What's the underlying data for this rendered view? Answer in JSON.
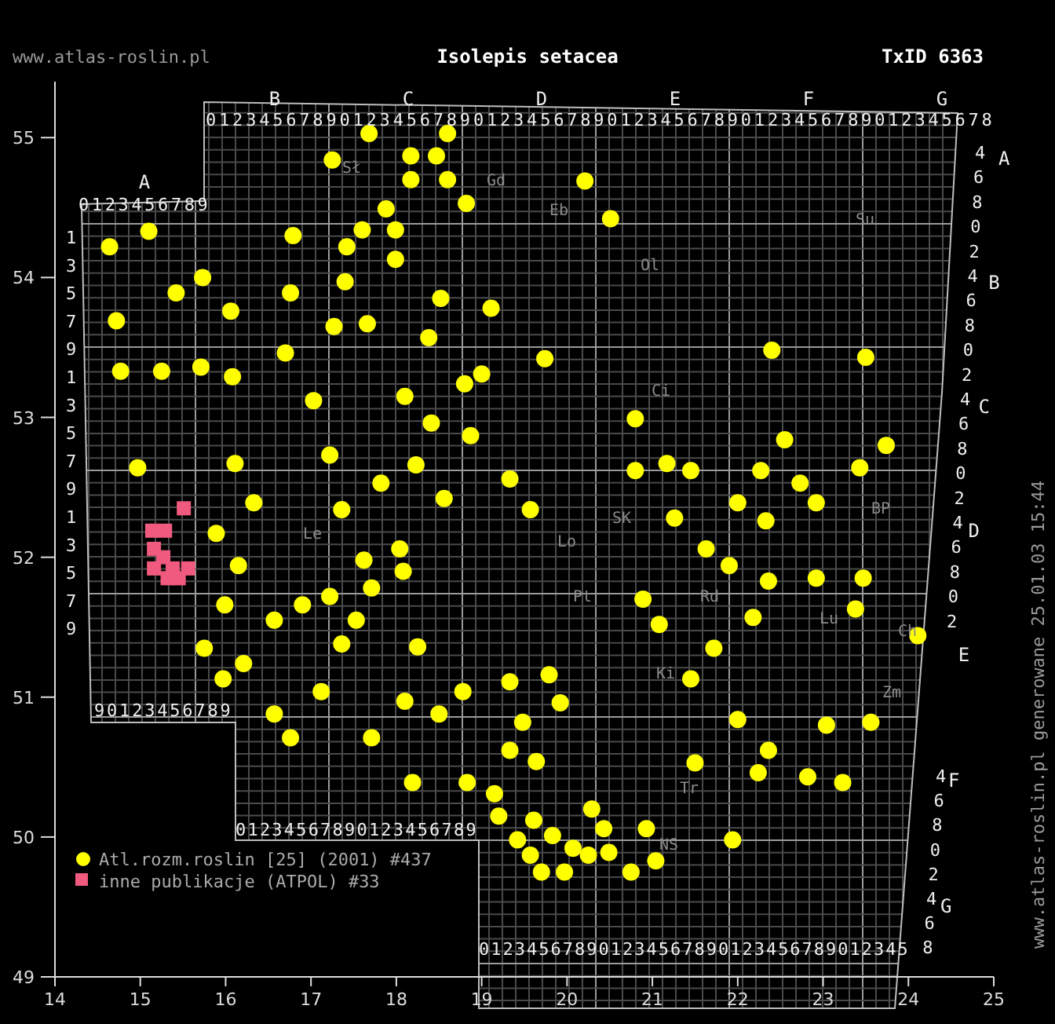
{
  "header": {
    "site": "www.atlas-roslin.pl",
    "title": "Isolepis setacea",
    "taxon_id": "TxID 6363"
  },
  "map": {
    "chart_data": {
      "type": "scatter",
      "grid": true,
      "xlim": [
        14,
        25
      ],
      "ylim": [
        49,
        55.4
      ],
      "xticks": [
        14,
        15,
        16,
        17,
        18,
        19,
        20,
        21,
        22,
        23,
        24,
        25
      ],
      "yticks": [
        49,
        50,
        51,
        52,
        53,
        54,
        55
      ],
      "series": [
        {
          "name": "Atl.rozm.roslin [25] (2001) #437",
          "color": "#ffff00",
          "x": [
            17.68,
            18.17,
            18.6,
            18.47,
            18.17,
            18.6,
            18.82,
            17.25,
            17.88,
            17.6,
            17.99,
            17.42,
            17.99,
            18.52,
            18.38,
            19.11,
            20.21,
            20.51,
            14.64,
            15.1,
            15.73,
            15.42,
            14.72,
            14.77,
            15.25,
            15.71,
            16.06,
            16.76,
            16.79,
            17.4,
            16.08,
            16.7,
            17.27,
            17.66,
            17.03,
            18.1,
            18.41,
            18.8,
            19.0,
            19.74,
            14.97,
            16.11,
            16.33,
            17.22,
            17.36,
            17.82,
            18.23,
            18.56,
            18.04,
            18.87,
            19.33,
            19.57,
            15.89,
            16.15,
            15.99,
            15.75,
            15.97,
            16.21,
            16.57,
            16.9,
            17.22,
            17.36,
            17.71,
            17.53,
            18.08,
            18.25,
            17.62,
            16.57,
            16.76,
            17.12,
            17.71,
            18.1,
            18.19,
            18.5,
            18.78,
            19.33,
            19.48,
            19.79,
            19.92,
            19.33,
            18.83,
            19.15,
            19.64,
            19.2,
            19.61,
            19.83,
            20.07,
            20.25,
            20.49,
            20.75,
            19.57,
            19.7,
            19.97,
            20.43,
            20.93,
            21.04,
            20.29,
            19.42,
            20.8,
            21.17,
            21.45,
            21.26,
            21.63,
            22.0,
            22.27,
            22.55,
            22.73,
            22.92,
            22.33,
            21.9,
            22.36,
            22.18,
            22.92,
            23.38,
            23.47,
            23.43,
            23.74,
            24.11,
            21.72,
            21.45,
            21.08,
            20.89,
            22.0,
            22.36,
            22.24,
            22.82,
            23.23,
            23.04,
            23.56,
            21.5,
            21.94,
            22.4,
            23.5,
            20.8
          ],
          "values": [
            55.03,
            54.87,
            55.03,
            54.87,
            54.7,
            54.7,
            54.53,
            54.84,
            54.49,
            54.34,
            54.34,
            54.22,
            54.13,
            53.85,
            53.57,
            53.78,
            54.69,
            54.42,
            54.22,
            54.33,
            54.0,
            53.89,
            53.69,
            53.33,
            53.33,
            53.36,
            53.76,
            53.89,
            54.3,
            53.97,
            53.29,
            53.46,
            53.65,
            53.67,
            53.12,
            53.15,
            52.96,
            53.24,
            53.31,
            53.42,
            52.64,
            52.67,
            52.39,
            52.73,
            52.34,
            52.53,
            52.66,
            52.42,
            52.06,
            52.87,
            52.56,
            52.34,
            52.17,
            51.94,
            51.66,
            51.35,
            51.13,
            51.24,
            51.55,
            51.66,
            51.72,
            51.38,
            51.78,
            51.55,
            51.9,
            51.36,
            51.98,
            50.88,
            50.71,
            51.04,
            50.71,
            50.97,
            50.39,
            50.88,
            51.04,
            51.11,
            50.82,
            51.16,
            50.96,
            50.62,
            50.39,
            50.31,
            50.54,
            50.15,
            50.12,
            50.01,
            49.92,
            49.87,
            49.89,
            49.75,
            49.87,
            49.75,
            49.75,
            50.06,
            50.06,
            49.83,
            50.2,
            49.98,
            52.62,
            52.67,
            52.62,
            52.28,
            52.06,
            52.39,
            52.62,
            52.84,
            52.53,
            52.39,
            52.26,
            51.94,
            51.83,
            51.57,
            51.85,
            51.63,
            51.85,
            52.64,
            52.8,
            51.44,
            51.35,
            51.13,
            51.52,
            51.7,
            50.84,
            50.62,
            50.46,
            50.43,
            50.39,
            50.8,
            50.82,
            50.53,
            49.98,
            53.48,
            53.43,
            52.99
          ]
        },
        {
          "name": "inne publikacje (ATPOL) #33",
          "color": "#f05a7e",
          "x": [
            15.51,
            15.14,
            15.29,
            15.16,
            15.27,
            15.38,
            15.16,
            15.32,
            15.45,
            15.56
          ],
          "values": [
            52.35,
            52.19,
            52.19,
            52.06,
            52.0,
            51.92,
            51.92,
            51.85,
            51.85,
            51.92
          ]
        }
      ]
    },
    "grid_labels": {
      "top_letters": [
        "B",
        "C",
        "D",
        "E",
        "F",
        "G"
      ],
      "top_digits": "01234567890123456789012345678901234567890123456789012345678",
      "column_a_letter": "A",
      "column_a_digits": "0123456789",
      "left_row_digits": [
        "1",
        "3",
        "5",
        "7",
        "9",
        "1",
        "3",
        "5",
        "7",
        "9",
        "1",
        "3",
        "5",
        "7",
        "9"
      ],
      "bottom_left_digits": "90123456789",
      "bottom_middle_digits": "01234567890123456789",
      "bottom_right_digits": "012345678901234567890123456789012345",
      "right_letters": [
        "A",
        "B",
        "C",
        "D",
        "E"
      ],
      "right_row_digits": [
        "4",
        "6",
        "8",
        "0",
        "2",
        "4",
        "6",
        "8",
        "0",
        "2",
        "4",
        "6",
        "8",
        "0",
        "2",
        "4",
        "6",
        "8",
        "0",
        "2"
      ],
      "lower_right_letters": [
        "F",
        "G"
      ],
      "lower_right_digits": [
        "4",
        "6",
        "8",
        "0",
        "2",
        "4",
        "6",
        "8"
      ]
    },
    "place_labels": [
      "Sł",
      "Gd",
      "Eb",
      "Ol",
      "Su",
      "Ci",
      "SK",
      "Lo",
      "Pt",
      "Rd",
      "Lu",
      "BP",
      "Ch",
      "Zm",
      "Ki",
      "Tr",
      "NS",
      "Le"
    ]
  },
  "footer_vertical": "www.atlas-roslin.pl generowane 25.01.03 15:44"
}
